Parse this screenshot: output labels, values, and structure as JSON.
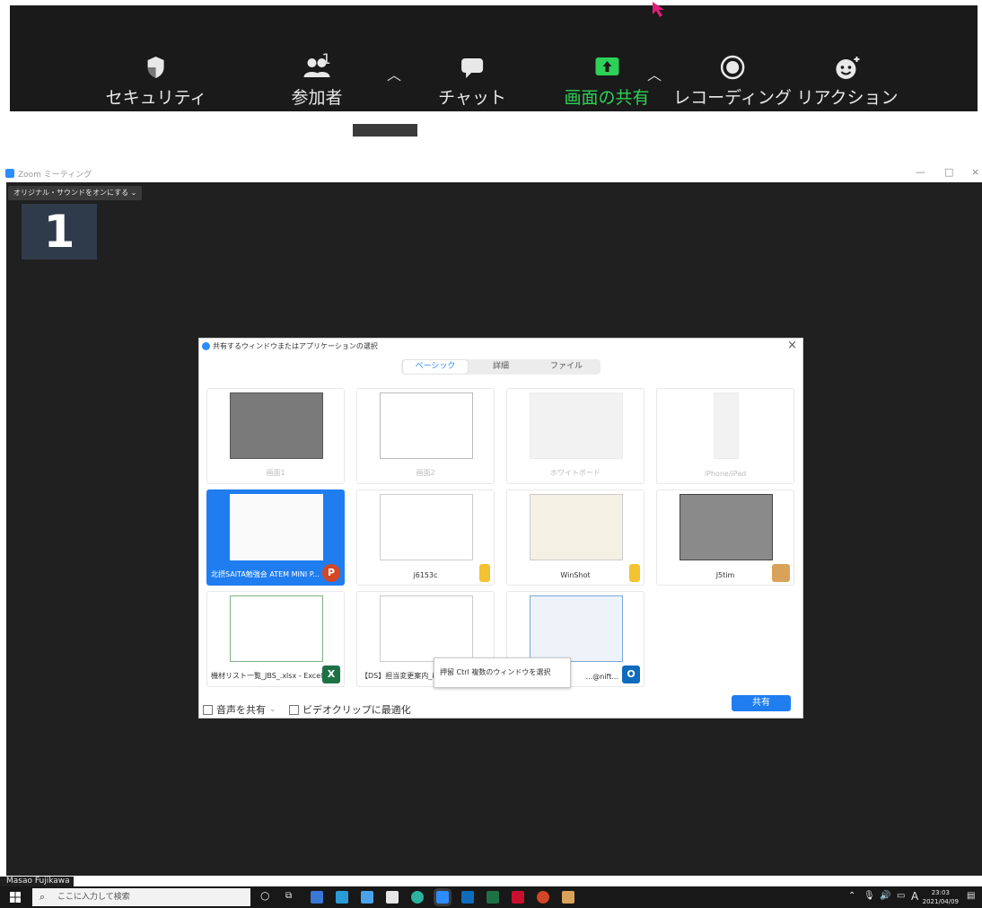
{
  "toolbar": {
    "security": "セキュリティ",
    "participants": "参加者",
    "participants_count": "1",
    "chat": "チャット",
    "share_screen": "画面の共有",
    "recording": "レコーディング",
    "reactions": "リアクション",
    "accent": "#2ed158"
  },
  "window": {
    "title": "Zoom ミーティング",
    "minimize": "—",
    "restore": "□",
    "close": "×",
    "original_sound": "オリジナル・サウンドをオンにする",
    "monitor_number": "1"
  },
  "dialog": {
    "title": "共有するウィンドウまたはアプリケーションの選択",
    "close": "×",
    "tabs": [
      "ベーシック",
      "詳細",
      "ファイル"
    ],
    "items": [
      {
        "caption": "画面1",
        "dim": true
      },
      {
        "caption": "画面2",
        "dim": true
      },
      {
        "caption": "ホワイトボード",
        "dim": true
      },
      {
        "caption": "iPhone/iPad",
        "dim": true
      },
      {
        "caption": "北摂SAITA勉強会 ATEM MINI P...",
        "app": "powerpoint-icon",
        "selected": true
      },
      {
        "caption": "j6153c",
        "app": "folder-icon"
      },
      {
        "caption": "WinShot",
        "app": "folder-icon"
      },
      {
        "caption": "J5tim",
        "app": "app-icon"
      },
      {
        "caption": "機材リスト一覧_JBS_.xlsx - Excel",
        "app": "excel-icon"
      },
      {
        "caption": "【DS】担当変更案内_iE...",
        "app": "word-icon"
      },
      {
        "caption": "...@nift...",
        "app": "outlook-icon"
      }
    ],
    "tooltip": "押留 Ctrl 複数のウィンドウを選択",
    "share_audio": "音声を共有",
    "optimize_video": "ビデオクリップに最適化",
    "share_button": "共有",
    "accent": "#1f7df0"
  },
  "participant_name": "Masao Fujikawa",
  "taskbar": {
    "search_placeholder": "ここに入力して検索",
    "ime": "A",
    "time": "23:03",
    "date": "2021/04/09"
  }
}
